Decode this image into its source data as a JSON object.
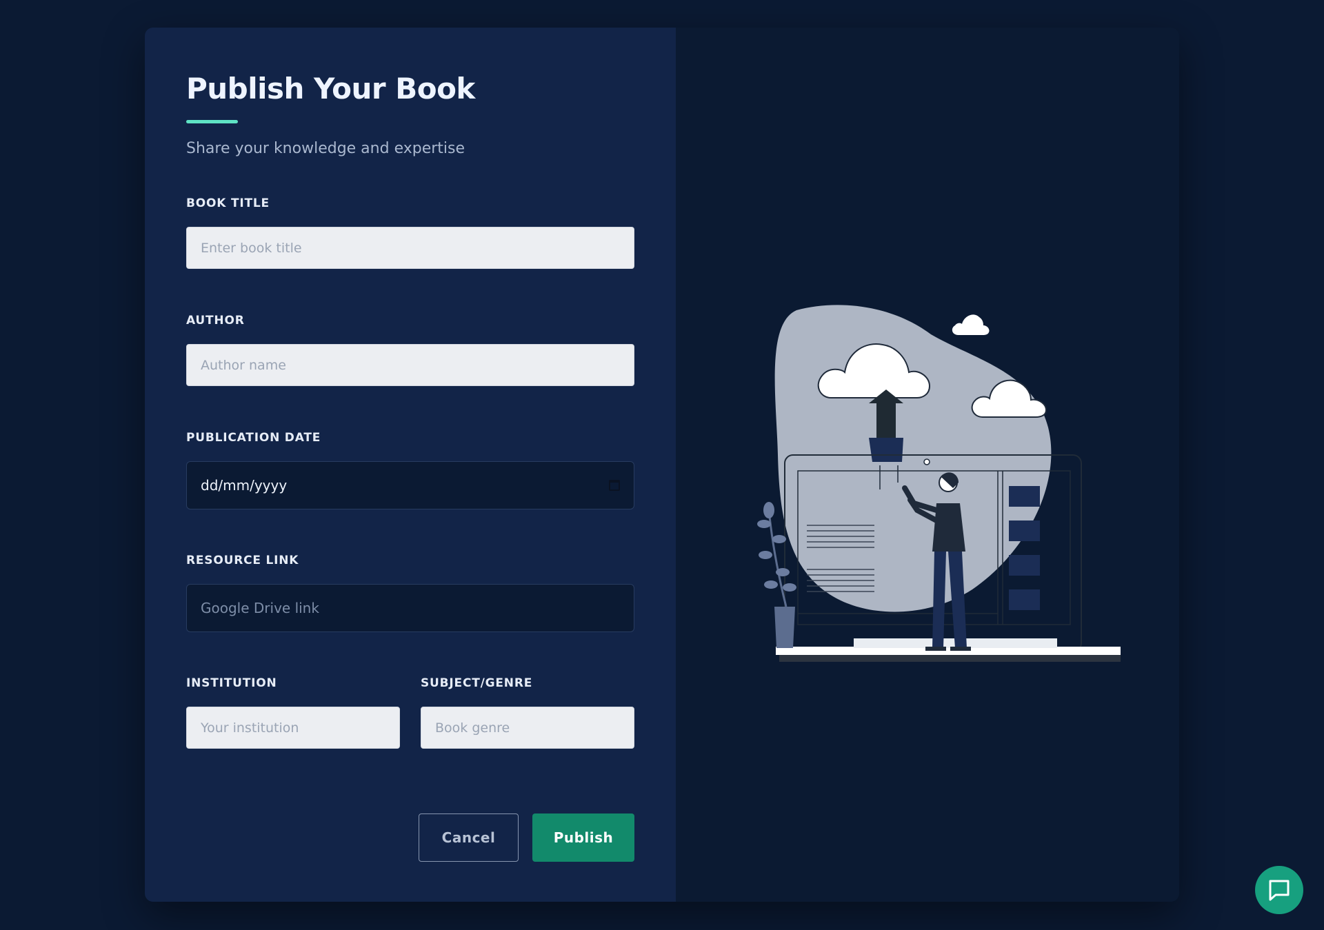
{
  "form": {
    "title": "Publish Your Book",
    "subtitle": "Share your knowledge and expertise",
    "fields": {
      "book_title": {
        "label": "BOOK TITLE",
        "placeholder": "Enter book title",
        "value": ""
      },
      "author": {
        "label": "AUTHOR",
        "placeholder": "Author name",
        "value": ""
      },
      "publication_date": {
        "label": "PUBLICATION DATE",
        "display": "dd/mm/yyyy"
      },
      "resource_link": {
        "label": "RESOURCE LINK",
        "placeholder": "Google Drive link",
        "value": ""
      },
      "institution": {
        "label": "INSTITUTION",
        "placeholder": "Your institution",
        "value": ""
      },
      "subject_genre": {
        "label": "SUBJECT/GENRE",
        "placeholder": "Book genre",
        "value": ""
      }
    },
    "actions": {
      "cancel_label": "Cancel",
      "publish_label": "Publish"
    }
  },
  "illustration": {
    "icon": "cloud-upload-person-illustration"
  },
  "chat": {
    "icon": "chat-bubble-icon"
  },
  "colors": {
    "background": "#0b1a33",
    "panel": "#122448",
    "accent": "#5fe3c5",
    "primary_button": "#128a6b",
    "chat_button": "#17a07f"
  }
}
